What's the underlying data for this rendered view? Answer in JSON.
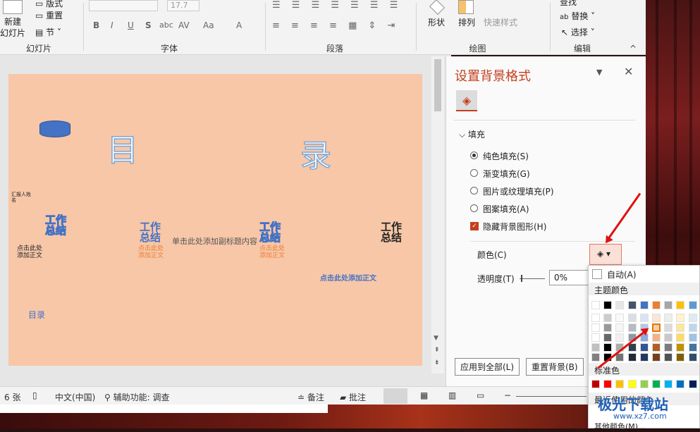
{
  "ribbon": {
    "slides": {
      "new_label": "新建",
      "new_label2": "幻灯片",
      "layout": "版式",
      "reset": "重置",
      "section": "节",
      "group": "幻灯片"
    },
    "font": {
      "size": "17.7",
      "group": "字体",
      "bold": "B",
      "italic": "I",
      "underline": "U",
      "shadow": "S",
      "strike": "abc",
      "spacing": "AV",
      "case": "Aa",
      "color": "A"
    },
    "paragraph": {
      "group": "段落"
    },
    "drawing": {
      "shapes": "形状",
      "arrange": "排列",
      "quick_styles": "快速样式",
      "group": "绘图"
    },
    "editing": {
      "find": "查找",
      "replace": "替换",
      "select": "选择",
      "group": "编辑"
    }
  },
  "slide": {
    "title_left": "目",
    "title_right": "录",
    "small_note": "汇报人姓名",
    "item1": "工作总结",
    "item2": "工作总结",
    "item3": "工作总结",
    "item4": "工作总结",
    "sub1": "点击此处添加正文",
    "subtitle": "单击此处添加副标题内容",
    "sub2": "点击此处添加正文",
    "sub3": "点击此处添加正文",
    "sub4": "点击此处添加正文",
    "toc": "目录"
  },
  "pane": {
    "title": "设置背景格式",
    "section": "填充",
    "options": [
      "纯色填充(S)",
      "渐变填充(G)",
      "图片或纹理填充(P)",
      "图案填充(A)"
    ],
    "hide_bg": "隐藏背景图形(H)",
    "color_label": "颜色(C)",
    "transparency_label": "透明度(T)",
    "transparency_value": "0%",
    "apply_all": "应用到全部(L)",
    "reset_bg": "重置背景(B)"
  },
  "palette": {
    "auto": "自动(A)",
    "theme": "主题颜色",
    "standard": "标准色",
    "recent": "最近使用的颜色",
    "more": "其他颜色(M)...",
    "theme_top": [
      "#ffffff",
      "#000000",
      "#e7e6e6",
      "#44546a",
      "#4472c4",
      "#ed7d31",
      "#a5a5a5",
      "#ffc000",
      "#5b9bd5"
    ],
    "standard_colors": [
      "#c00000",
      "#ff0000",
      "#ffc000",
      "#ffff00",
      "#92d050",
      "#00b050",
      "#00b0f0",
      "#0070c0",
      "#002060"
    ]
  },
  "status": {
    "slides": "6 张",
    "lang": "中文(中国)",
    "accessibility": "辅助功能: 调查",
    "notes": "备注",
    "comments": "批注"
  },
  "watermark": "极光下载站",
  "watermark_url": "www.xz7.com"
}
